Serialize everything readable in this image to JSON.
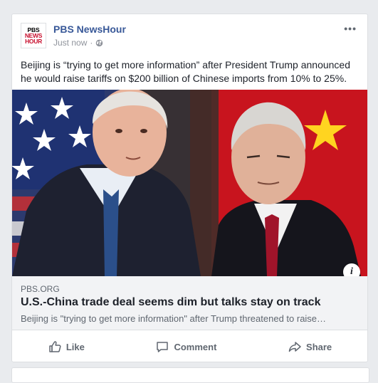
{
  "post": {
    "page_name": "PBS NewsHour",
    "logo": {
      "line1": "PBS",
      "line2": "NEWS",
      "line3": "HOUR"
    },
    "timestamp": "Just now",
    "separator": "·",
    "audience_icon": "globe-icon",
    "more_icon": "•••",
    "text": "Beijing is “trying to get more information” after President Trump announced he would raise tariffs on $200 billion of Chinese imports from 10% to 25%."
  },
  "link": {
    "domain": "PBS.ORG",
    "headline": "U.S.-China trade deal seems dim but talks stay on track",
    "description": "Beijing is \"trying to get more information\" after Trump threatened to raise…",
    "info_label": "i"
  },
  "actions": {
    "like": "Like",
    "comment": "Comment",
    "share": "Share"
  },
  "colors": {
    "page_name": "#385898",
    "background": "#e9ebee",
    "link_box": "#f2f3f5",
    "logo_red": "#c8102e"
  }
}
